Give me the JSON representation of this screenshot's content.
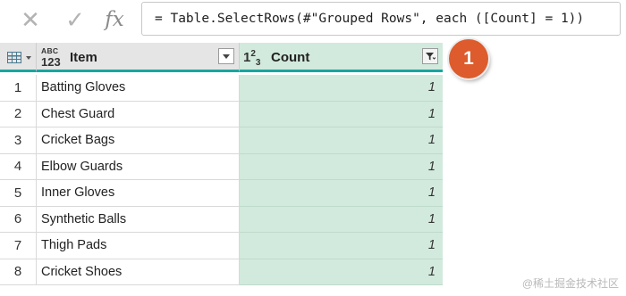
{
  "formula_bar": {
    "cancel_icon": "x-icon",
    "cancel_glyph": "✕",
    "confirm_icon": "check-icon",
    "confirm_glyph": "✓",
    "fx_label": "fx",
    "formula": "= Table.SelectRows(#\"Grouped Rows\", each ([Count] = 1))"
  },
  "table": {
    "columns": [
      {
        "type_top": "ABC",
        "type_bottom": "123",
        "label": "Item"
      },
      {
        "type_main": "1",
        "type_sup": "2",
        "type_sub": "3",
        "label": "Count",
        "filtered": true
      }
    ],
    "rows": [
      {
        "n": "1",
        "item": "Batting Gloves",
        "count": "1"
      },
      {
        "n": "2",
        "item": "Chest Guard",
        "count": "1"
      },
      {
        "n": "3",
        "item": "Cricket Bags",
        "count": "1"
      },
      {
        "n": "4",
        "item": "Elbow Guards",
        "count": "1"
      },
      {
        "n": "5",
        "item": "Inner Gloves",
        "count": "1"
      },
      {
        "n": "6",
        "item": "Synthetic Balls",
        "count": "1"
      },
      {
        "n": "7",
        "item": "Thigh Pads",
        "count": "1"
      },
      {
        "n": "8",
        "item": "Cricket Shoes",
        "count": "1"
      }
    ]
  },
  "callout": {
    "label": "1",
    "color": "#dd5b2c"
  },
  "colors": {
    "accent": "#18a6a0",
    "selected_column": "#d2eadd"
  },
  "watermark": "@稀土掘金技术社区"
}
